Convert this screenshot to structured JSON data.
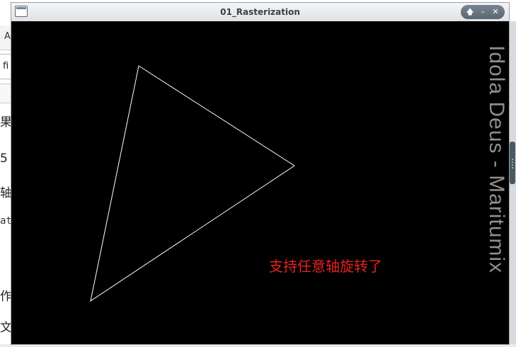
{
  "background_app": {
    "tab_label": "A",
    "input_value": "fi",
    "text_fragments": [
      "果",
      "5",
      "轴",
      "at",
      "作",
      "文"
    ]
  },
  "window": {
    "title": "01_Rasterization",
    "controls": {
      "up": "🡅",
      "minimize": "–",
      "close": "✕"
    }
  },
  "canvas": {
    "background": "#000000",
    "shape": {
      "type": "triangle",
      "stroke": "#ffffff",
      "fill": "none"
    },
    "overlay_text": "支持任意轴旋转了",
    "overlay_color": "#e52121"
  },
  "watermark": {
    "text": "Idola Deus - Maritumix",
    "color": "#8f8f8f"
  }
}
